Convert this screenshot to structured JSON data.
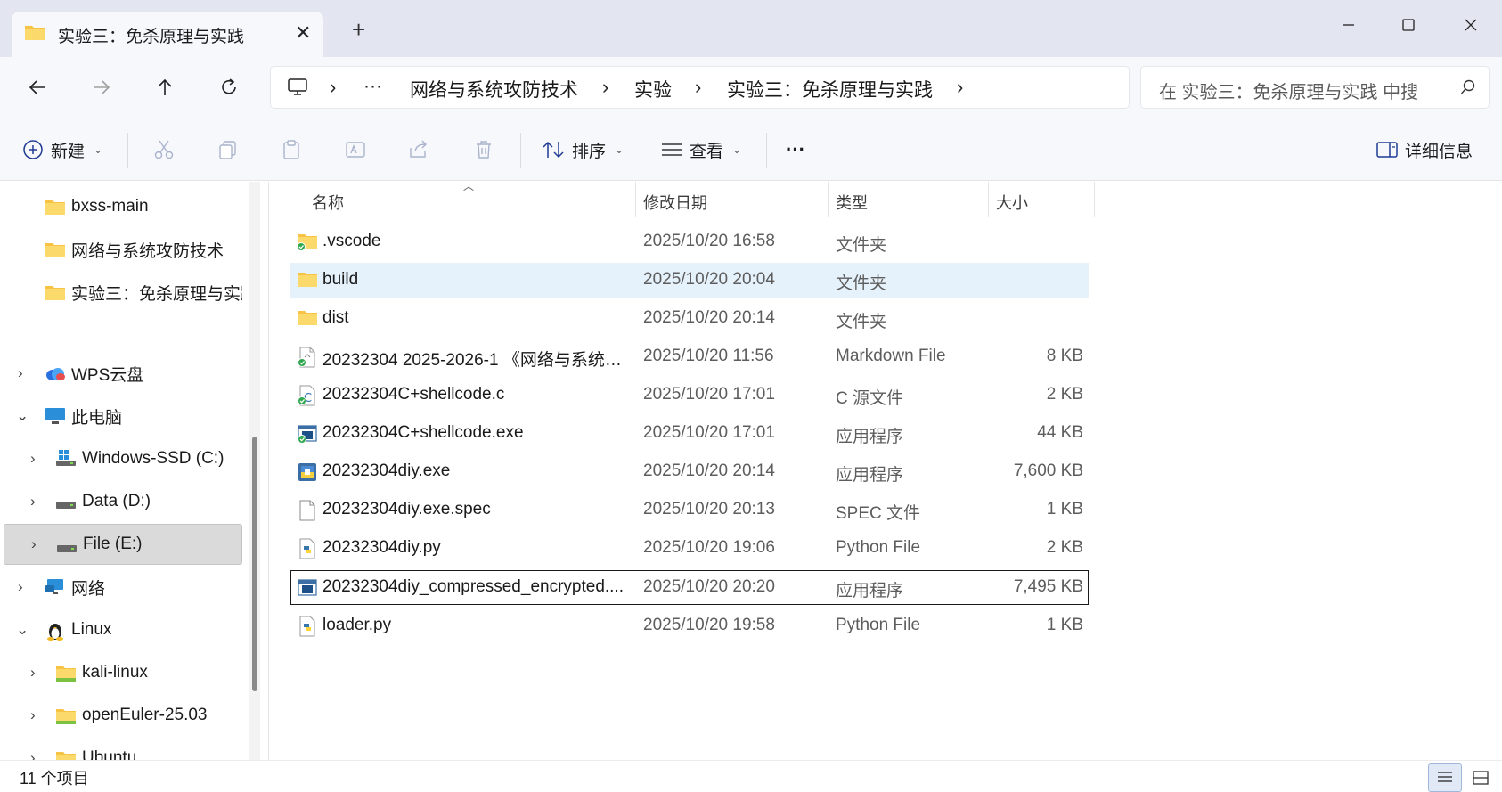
{
  "window": {
    "tab_title": "实验三：免杀原理与实践",
    "tab_close": "✕",
    "new_tab": "+"
  },
  "address": {
    "overflow": "···",
    "crumbs": [
      "网络与系统攻防技术",
      "实验",
      "实验三：免杀原理与实践"
    ],
    "separator": "›"
  },
  "search": {
    "placeholder": "在 实验三：免杀原理与实践 中搜"
  },
  "commands": {
    "new_label": "新建",
    "sort_label": "排序",
    "view_label": "查看",
    "more_label": "···",
    "details_label": "详细信息"
  },
  "sidebar": {
    "items": [
      {
        "label": "bxss-main"
      },
      {
        "label": "网络与系统攻防技术"
      },
      {
        "label": "实验三：免杀原理与实践"
      },
      {
        "label": "WPS云盘"
      },
      {
        "label": "此电脑"
      },
      {
        "label": "Windows-SSD (C:)"
      },
      {
        "label": "Data (D:)"
      },
      {
        "label": "File (E:)"
      },
      {
        "label": "网络"
      },
      {
        "label": "Linux"
      },
      {
        "label": "kali-linux"
      },
      {
        "label": "openEuler-25.03"
      },
      {
        "label": "Ubuntu"
      }
    ]
  },
  "columns": {
    "name": "名称",
    "modified": "修改日期",
    "type": "类型",
    "size": "大小"
  },
  "files": [
    {
      "name": ".vscode",
      "date": "2025/10/20 16:58",
      "type": "文件夹",
      "size": ""
    },
    {
      "name": "build",
      "date": "2025/10/20 20:04",
      "type": "文件夹",
      "size": ""
    },
    {
      "name": "dist",
      "date": "2025/10/20 20:14",
      "type": "文件夹",
      "size": ""
    },
    {
      "name": "20232304 2025-2026-1 《网络与系统…",
      "date": "2025/10/20 11:56",
      "type": "Markdown File",
      "size": "8 KB"
    },
    {
      "name": "20232304C+shellcode.c",
      "date": "2025/10/20 17:01",
      "type": "C 源文件",
      "size": "2 KB"
    },
    {
      "name": "20232304C+shellcode.exe",
      "date": "2025/10/20 17:01",
      "type": "应用程序",
      "size": "44 KB"
    },
    {
      "name": "20232304diy.exe",
      "date": "2025/10/20 20:14",
      "type": "应用程序",
      "size": "7,600 KB"
    },
    {
      "name": "20232304diy.exe.spec",
      "date": "2025/10/20 20:13",
      "type": "SPEC 文件",
      "size": "1 KB"
    },
    {
      "name": "20232304diy.py",
      "date": "2025/10/20 19:06",
      "type": "Python File",
      "size": "2 KB"
    },
    {
      "name": "20232304diy_compressed_encrypted....",
      "date": "2025/10/20 20:20",
      "type": "应用程序",
      "size": "7,495 KB"
    },
    {
      "name": "loader.py",
      "date": "2025/10/20 19:58",
      "type": "Python File",
      "size": "1 KB"
    }
  ],
  "status": {
    "count_text": "11 个项目"
  }
}
